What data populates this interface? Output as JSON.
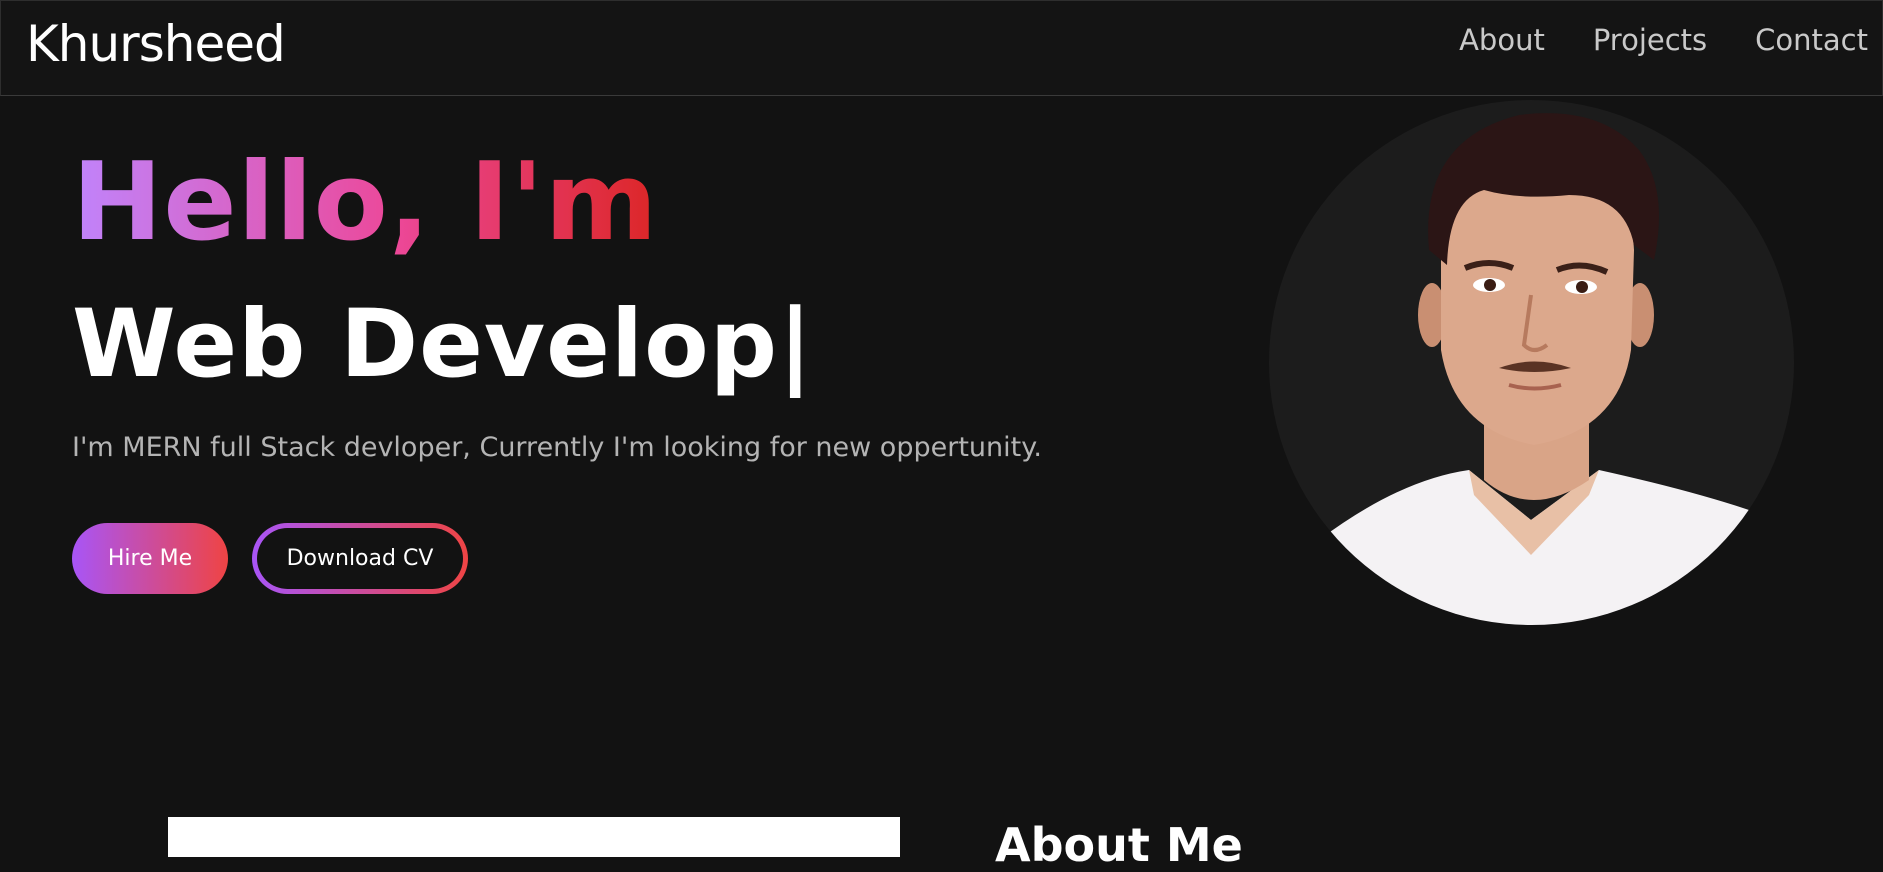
{
  "navbar": {
    "brand": "Khursheed",
    "links": [
      {
        "label": "About"
      },
      {
        "label": "Projects"
      },
      {
        "label": "Contact"
      }
    ]
  },
  "hero": {
    "greeting": "Hello, I'm",
    "role_typed": "Web Develop|",
    "tagline": "I'm MERN full Stack devloper, Currently I'm looking for new oppertunity.",
    "hire_button": "Hire Me",
    "cv_button": "Download CV"
  },
  "about": {
    "title": "About Me"
  },
  "colors": {
    "background": "#121212",
    "gradient_start": "#c084fc",
    "gradient_mid": "#ec4899",
    "gradient_end": "#dc2626"
  }
}
